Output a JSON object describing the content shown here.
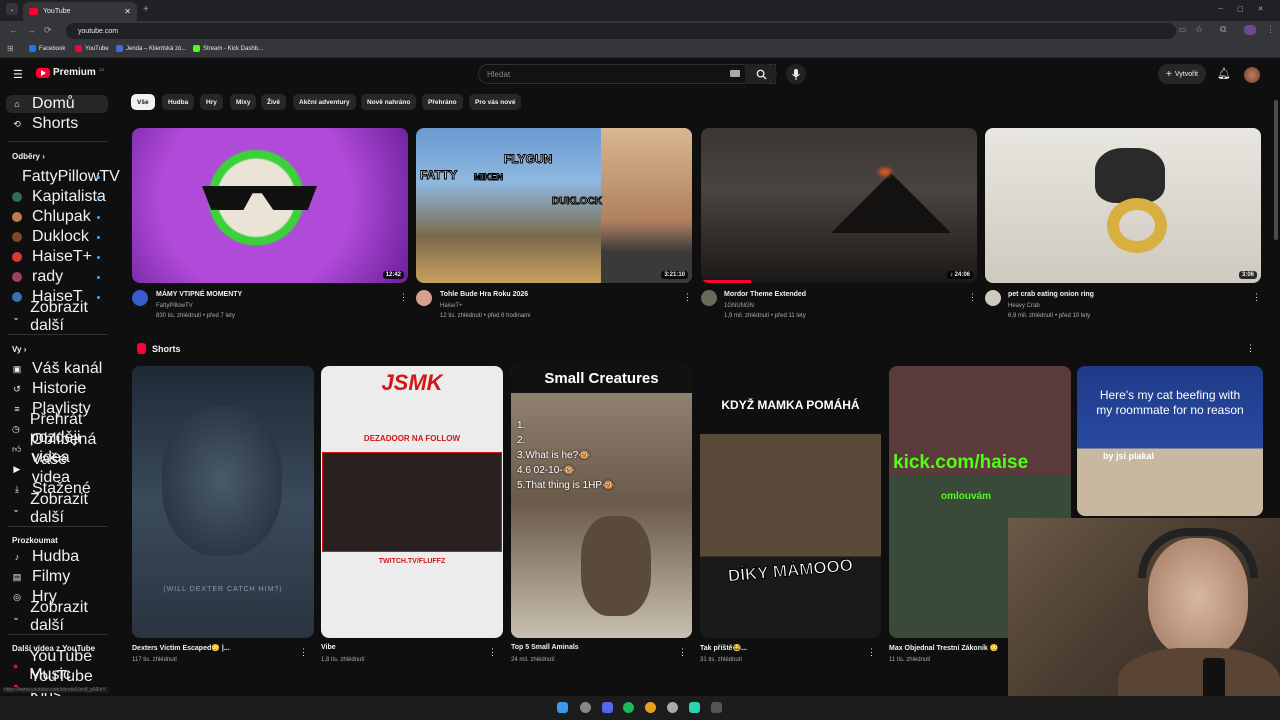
{
  "browser": {
    "tab_title": "YouTube",
    "url": "youtube.com",
    "bookmarks": [
      "Facebook",
      "YouTube",
      "Jenda – Klientská zó...",
      "Stream - Kick Dashb..."
    ],
    "status_url": "https://www.youtube.com/shorts/Uzn8_pN6nY"
  },
  "header": {
    "logo": "Premium",
    "country": "CZ",
    "search_placeholder": "Hledat",
    "create_label": "Vytvořit"
  },
  "sidebar": {
    "main": [
      {
        "label": "Domů",
        "icon": "home-icon"
      },
      {
        "label": "Shorts",
        "icon": "shorts-icon"
      }
    ],
    "subs_heading": "Odběry",
    "subscriptions": [
      {
        "label": "FattyPillowTV",
        "color": "#3a5ccf"
      },
      {
        "label": "Kapitalista",
        "color": "#2f6f4f"
      },
      {
        "label": "Chlupak",
        "color": "#c07a50"
      },
      {
        "label": "Duklock",
        "color": "#7a4a2a"
      },
      {
        "label": "HaiseT+",
        "color": "#d83a3a"
      },
      {
        "label": "rady",
        "color": "#a04060"
      },
      {
        "label": "HaiseT",
        "color": "#3a6fb0"
      }
    ],
    "show_more": "Zobrazit další",
    "you_heading": "Vy",
    "you": [
      {
        "label": "Váš kanál",
        "icon": "channel-icon"
      },
      {
        "label": "Historie",
        "icon": "history-icon"
      },
      {
        "label": "Playlisty",
        "icon": "playlist-icon"
      },
      {
        "label": "Přehrát později",
        "icon": "clock-icon"
      },
      {
        "label": "Oblíbená videa",
        "icon": "thumb-up-icon"
      },
      {
        "label": "Vaše videa",
        "icon": "video-icon"
      },
      {
        "label": "Stažené",
        "icon": "download-icon"
      },
      {
        "label": "Zobrazit další",
        "icon": "chevron-down-icon"
      }
    ],
    "explore_heading": "Prozkoumat",
    "explore": [
      {
        "label": "Hudba",
        "icon": "music-icon"
      },
      {
        "label": "Filmy",
        "icon": "film-icon"
      },
      {
        "label": "Hry",
        "icon": "gamepad-icon"
      },
      {
        "label": "Zobrazit další",
        "icon": "chevron-down-icon"
      }
    ],
    "more_heading": "Další videa z YouTube",
    "more": [
      {
        "label": "YouTube Music"
      },
      {
        "label": "YouTube Kids"
      }
    ]
  },
  "chips": [
    "Vše",
    "Hudba",
    "Hry",
    "Mixy",
    "Živě",
    "Akční adventury",
    "Nově nahráno",
    "Přehráno",
    "Pro vás nové"
  ],
  "videos": [
    {
      "title": "MÁMY VTIPNÉ MOMENTY",
      "channel": "FattyPillowTV",
      "meta": "830 tis. zhlédnutí • před 7 lety",
      "duration": "12:42",
      "bg": "#8a2fb0",
      "accent": "#3ad13a"
    },
    {
      "title": "Tohle Bude Hra Roku 2026",
      "channel": "HaiseT+",
      "meta": "12 tis. zhlédnutí • před 6 hodinami",
      "duration": "3:21:10",
      "bg": "#5a8ac0",
      "accent": "#c8a060"
    },
    {
      "title": "Mordor Theme Extended",
      "channel": "1GNUNGN",
      "meta": "1,9 mil. zhlédnutí • před 11 lety",
      "duration": "24:06",
      "bg": "#2a2624",
      "accent": "#e05a20"
    },
    {
      "title": "pet crab eating onion ring",
      "channel": "Heavy Crab",
      "meta": "6,9 mil. zhlédnutí • před 10 lety",
      "duration": "3:06",
      "bg": "#d8d4cc",
      "accent": "#d8b040"
    }
  ],
  "thumb_text": {
    "fatty": "FATTY",
    "miken": "MIKEN",
    "flygun": "FLYGUN",
    "duklock": "DUKLOCK"
  },
  "shorts_heading": "Shorts",
  "shorts": [
    {
      "title": "Dexters Victim Escaped😳 |...",
      "views": "117 tis. zhlédnutí",
      "overlay": "(WILL DEXTER CATCH HIM?)",
      "bg": "#2b3a4a"
    },
    {
      "title": "Vibe",
      "views": "1,8 tis. zhlédnutí",
      "overlay": "JSMK",
      "bg": "#e8e8e8"
    },
    {
      "title": "Top 5 Small Aminals",
      "views": "24 mil. zhlédnutí",
      "overlay": "Small Creatures",
      "bg": "#7a6a5a"
    },
    {
      "title": "Tak příště😂...",
      "views": "31 tis. zhlédnutí",
      "overlay": "KDYŽ MAMKA POMÁHÁ",
      "bg": "#1a1a1a"
    },
    {
      "title": "Max Objednal Trestní Zákoník 😳",
      "views": "11 tis. zhlédnutí",
      "overlay": "kick.com/haise",
      "bg": "#4a3a3a"
    },
    {
      "title": "",
      "views": "",
      "overlay": "Here's my cat beefing with my roommate for no reason",
      "bg": "#1e3a8a"
    }
  ],
  "short_extras": {
    "jsmk_sub": "DEZADOOR NA FOLLOW",
    "jsmk_link": "TWITCH.TV/FLUFFZ",
    "creatures_list": [
      "1.",
      "2.",
      "3.What is he?🐵",
      "4.6 02-10-🐵",
      "5.That thing is 1HP🐵"
    ],
    "mamka_bottom": "DÍKY MÁMOOO",
    "kick_sub": "omlouvám",
    "cat_sub": "by jsi plakal"
  }
}
